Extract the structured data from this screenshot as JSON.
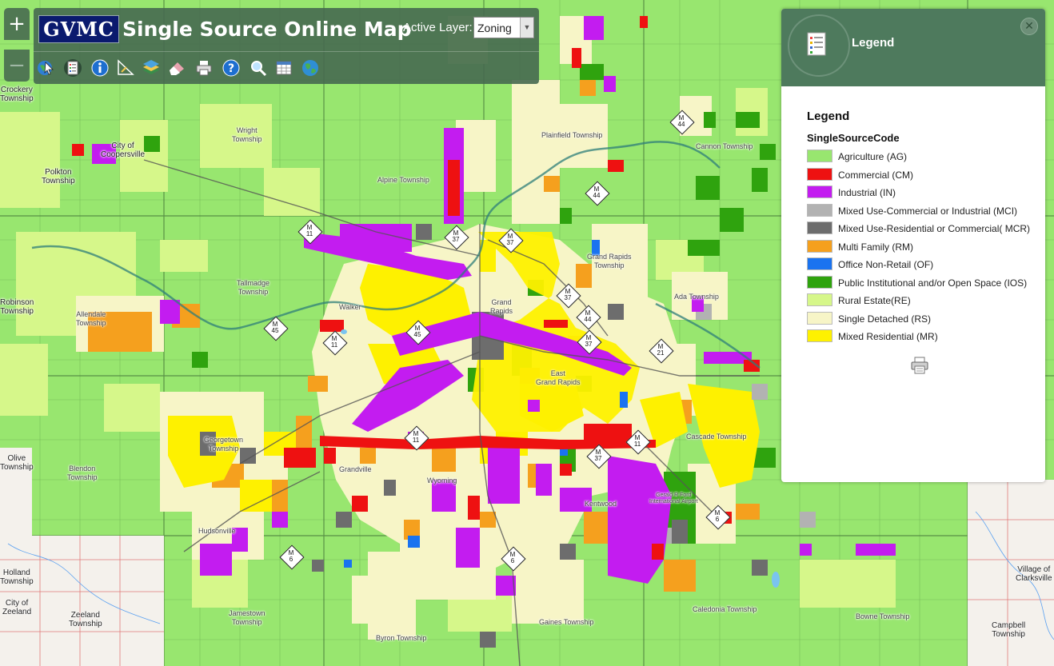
{
  "header": {
    "logo_text": "GVMC",
    "title": "Single Source Online Map",
    "active_layer_label": "Active Layer:",
    "active_layer_value": "Zoning"
  },
  "zoom": {
    "in": "+",
    "out": "−"
  },
  "toolbar_icons": [
    "globe-cursor-icon",
    "list-icon",
    "info-icon",
    "measure-icon",
    "layers-icon",
    "eraser-icon",
    "print-icon",
    "help-icon",
    "search-icon",
    "table-icon",
    "world-icon"
  ],
  "legend": {
    "panel_title": "Legend",
    "body_title": "Legend",
    "field": "SingleSourceCode",
    "items": [
      {
        "label": "Agriculture (AG)",
        "color": "#98e66f"
      },
      {
        "label": "Commercial (CM)",
        "color": "#ee1111"
      },
      {
        "label": "Industrial (IN)",
        "color": "#c31cf0"
      },
      {
        "label": "Mixed Use-Commercial or Industrial (MCI)",
        "color": "#b2b2b2"
      },
      {
        "label": "Mixed Use-Residential or Commercial( MCR)",
        "color": "#6d6d6d"
      },
      {
        "label": "Multi Family (RM)",
        "color": "#f5a01e"
      },
      {
        "label": "Office Non-Retail (OF)",
        "color": "#1a73f0"
      },
      {
        "label": "Public Institutional and/or Open Space (IOS)",
        "color": "#2fa30e"
      },
      {
        "label": "Rural Estate(RE)",
        "color": "#d6f78a"
      },
      {
        "label": "Single Detached (RS)",
        "color": "#f7f5c7"
      },
      {
        "label": "Mixed Residential (MR)",
        "color": "#fef100"
      }
    ]
  },
  "map_labels": {
    "crockery": "Crockery\nTownship",
    "coopersville": "City of\nCoopersville",
    "polkton": "Polkton\nTownship",
    "wright": "Wright\nTownship",
    "alpine": "Alpine Township",
    "plainfield": "Plainfield Township",
    "cannon": "Cannon Township",
    "robinson": "Robinson\nTownship",
    "allendale": "Allendale\nTownship",
    "tallmadge": "Tallmadge\nTownship",
    "walker": "Walker",
    "grand_rapids": "Grand\nRapids",
    "gr_township": "Grand Rapids\nTownship",
    "ada": "Ada Township",
    "east_gr": "East\nGrand Rapids",
    "olive": "Olive\nTownship",
    "blendon": "Blendon\nTownship",
    "georgetown": "Georgetown\nTownship",
    "grandville": "Grandville",
    "wyoming": "Wyoming",
    "kentwood": "Kentwood",
    "cascade": "Cascade Township",
    "hudsonville": "Hudsonville",
    "holland": "Holland\nTownship",
    "zeeland_city": "City of\nZeeland",
    "zeeland_twp": "Zeeland\nTownship",
    "jamestown": "Jamestown\nTownship",
    "byron": "Byron Township",
    "gaines": "Gaines Township",
    "caledonia": "Caledonia Township",
    "bowne": "Bowne Township",
    "clarksville": "Village of\nClarksville",
    "campbell": "Campbell\nTownship",
    "airport": "Gerald R Ford\nInternational Airport"
  },
  "route_shields": [
    {
      "top": "M",
      "num": "11"
    },
    {
      "top": "M",
      "num": "37"
    },
    {
      "top": "M",
      "num": "37"
    },
    {
      "top": "M",
      "num": "44"
    },
    {
      "top": "M",
      "num": "44"
    },
    {
      "top": "M",
      "num": "37"
    },
    {
      "top": "M",
      "num": "44"
    },
    {
      "top": "M",
      "num": "37"
    },
    {
      "top": "M",
      "num": "45"
    },
    {
      "top": "M",
      "num": "11"
    },
    {
      "top": "M",
      "num": "45"
    },
    {
      "top": "M",
      "num": "21"
    },
    {
      "top": "M",
      "num": "11"
    },
    {
      "top": "M",
      "num": "11"
    },
    {
      "top": "M",
      "num": "37"
    },
    {
      "top": "M",
      "num": "6"
    },
    {
      "top": "M",
      "num": "6"
    },
    {
      "top": "M",
      "num": "6"
    }
  ]
}
